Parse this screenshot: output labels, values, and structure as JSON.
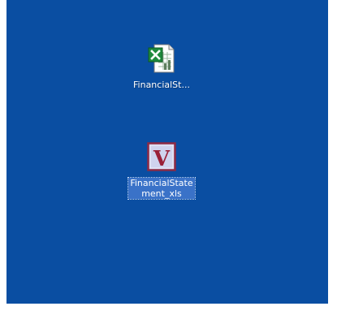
{
  "desktop": {
    "background_color": "#0a4ea2",
    "icons": [
      {
        "label": "FinancialSt...",
        "icon": "excel-spreadsheet-icon",
        "selected": false
      },
      {
        "label": "FinancialState\nment_xls",
        "icon": "v-document-icon",
        "selected": true
      }
    ]
  }
}
